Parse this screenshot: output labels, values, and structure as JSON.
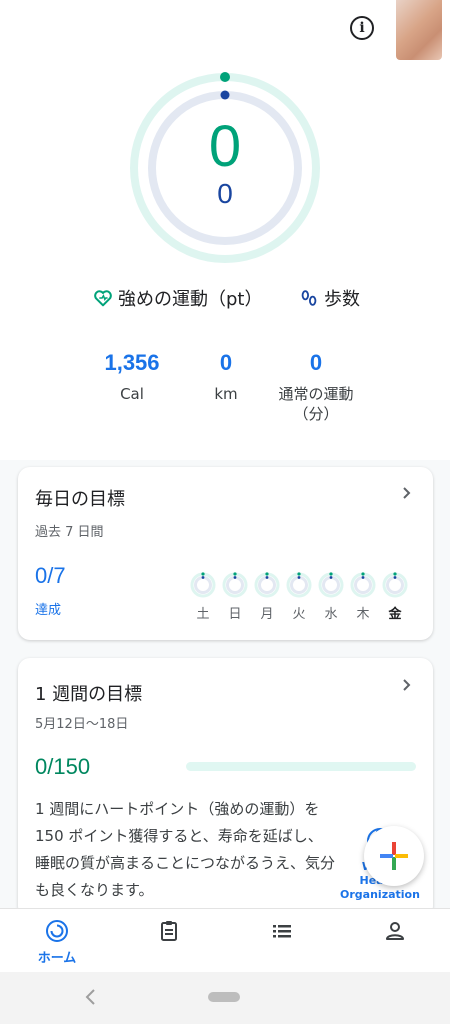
{
  "header": {
    "info_icon": "info-icon",
    "info_glyph": "i",
    "avatar": "profile-avatar"
  },
  "ring": {
    "heart_points_value": "0",
    "steps_value": "0",
    "heart_points_progress": 0,
    "steps_progress": 0,
    "colors": {
      "heart": "#00a279",
      "steps": "#1a46a0",
      "heart_track": "#def5f0",
      "steps_track": "#e3e8f2"
    }
  },
  "legend": {
    "heart_label": "強めの運動（pt）",
    "heart_icon": "heart-points-icon",
    "steps_label": "歩数",
    "steps_icon": "steps-icon"
  },
  "stats": {
    "calories": {
      "value": "1,356",
      "label": "Cal"
    },
    "distance": {
      "value": "0",
      "label": "km"
    },
    "move_minutes": {
      "value": "0",
      "label_line1": "通常の運動",
      "label_line2": "（分）"
    }
  },
  "daily_goal": {
    "title": "毎日の目標",
    "subtitle": "過去 7 日間",
    "value": "0/7",
    "status": "達成",
    "days": [
      {
        "label": "土",
        "today": false
      },
      {
        "label": "日",
        "today": false
      },
      {
        "label": "月",
        "today": false
      },
      {
        "label": "火",
        "today": false
      },
      {
        "label": "水",
        "today": false
      },
      {
        "label": "木",
        "today": false
      },
      {
        "label": "金",
        "today": true
      }
    ]
  },
  "weekly_goal": {
    "title": "1 週間の目標",
    "date_range": "5月12日〜18日",
    "value": "0/150",
    "progress": 0,
    "description": "1 週間にハートポイント（強めの運動）を 150 ポイント獲得すると、寿命を延ばし、睡眠の質が高まることにつながるうえ、気分も良くなります。",
    "partner_line1": "World Health",
    "partner_line2": "Organization"
  },
  "fab": {
    "icon": "add-icon"
  },
  "bottom_nav": {
    "items": [
      {
        "name": "home",
        "label": "ホーム",
        "active": true
      },
      {
        "name": "journal",
        "label": "",
        "active": false
      },
      {
        "name": "browse",
        "label": "",
        "active": false
      },
      {
        "name": "profile",
        "label": "",
        "active": false
      }
    ]
  },
  "system_nav": {
    "back_icon": "back-icon",
    "home_icon": "home-pill"
  }
}
